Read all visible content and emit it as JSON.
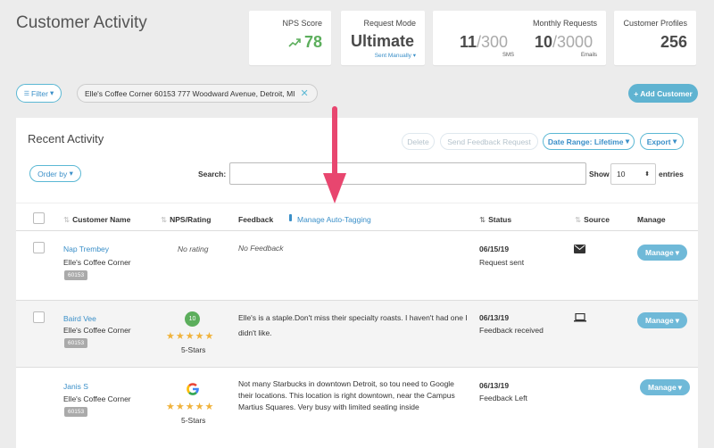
{
  "page_title": "Customer Activity",
  "cards": {
    "nps": {
      "label": "NPS Score",
      "value": "78",
      "color": "#5cae5c"
    },
    "mode": {
      "label": "Request Mode",
      "value": "Ultimate",
      "sub": "Sent Manually"
    },
    "monthly": {
      "label": "Monthly Requests",
      "sms_used": "11",
      "sms_total": "/300",
      "sms_label": "SMS",
      "email_used": "10",
      "email_total": "/3000",
      "email_label": "Emails"
    },
    "profiles": {
      "label": "Customer Profiles",
      "value": "256"
    }
  },
  "filter": {
    "button_label": "Filter",
    "chip_text": "Elle's Coffee Corner 60153 777 Woodward Avenue, Detroit, MI"
  },
  "add_customer_label": "+ Add Customer",
  "panel": {
    "title": "Recent Activity",
    "delete_label": "Delete",
    "send_feedback_label": "Send Feedback Request",
    "date_range_label": "Date Range: Lifetime",
    "export_label": "Export",
    "order_by_label": "Order by",
    "search_label": "Search:",
    "search_value": "",
    "show_label": "Show",
    "show_value": "10",
    "entries_label": "entries"
  },
  "table": {
    "headers": {
      "customer_name": "Customer Name",
      "nps_rating": "NPS/Rating",
      "feedback": "Feedback",
      "manage_auto_tagging": "Manage Auto-Tagging",
      "status": "Status",
      "source": "Source",
      "manage": "Manage"
    },
    "rows": [
      {
        "name": "Nap Trembey",
        "business": "Elle's Coffee Corner",
        "tag": "60153",
        "rating": "No rating",
        "feedback": "No Feedback",
        "date": "06/15/19",
        "status": "Request sent",
        "source": "email-icon",
        "manage": "Manage"
      },
      {
        "name": "Baird Vee",
        "business": "Elle's Coffee Corner",
        "tag": "60153",
        "nps": "10",
        "stars": "★★★★★",
        "stars_label": "5-Stars",
        "feedback": "Elle's is a staple.Don't miss their specialty roasts. I haven't had one I didn't like.",
        "date": "06/13/19",
        "status": "Feedback received",
        "source": "laptop-icon",
        "manage": "Manage"
      },
      {
        "name": "Janis S",
        "business": "Elle's Coffee Corner",
        "tag": "60153",
        "stars": "★★★★★",
        "stars_label": "5-Stars",
        "feedback": "Not many Starbucks in downtown Detroit, so tou need to Google their locations. This location is right downtown, near the Campus Martius Squares. Very busy with limited seating inside",
        "date": "06/13/19",
        "status": "Feedback Left",
        "source": "google-icon",
        "manage": "Manage"
      }
    ]
  },
  "colors": {
    "accent": "#3a8fc8",
    "button": "#6fb9d8",
    "arrow": "#e8466f",
    "star": "#f0b23a"
  }
}
